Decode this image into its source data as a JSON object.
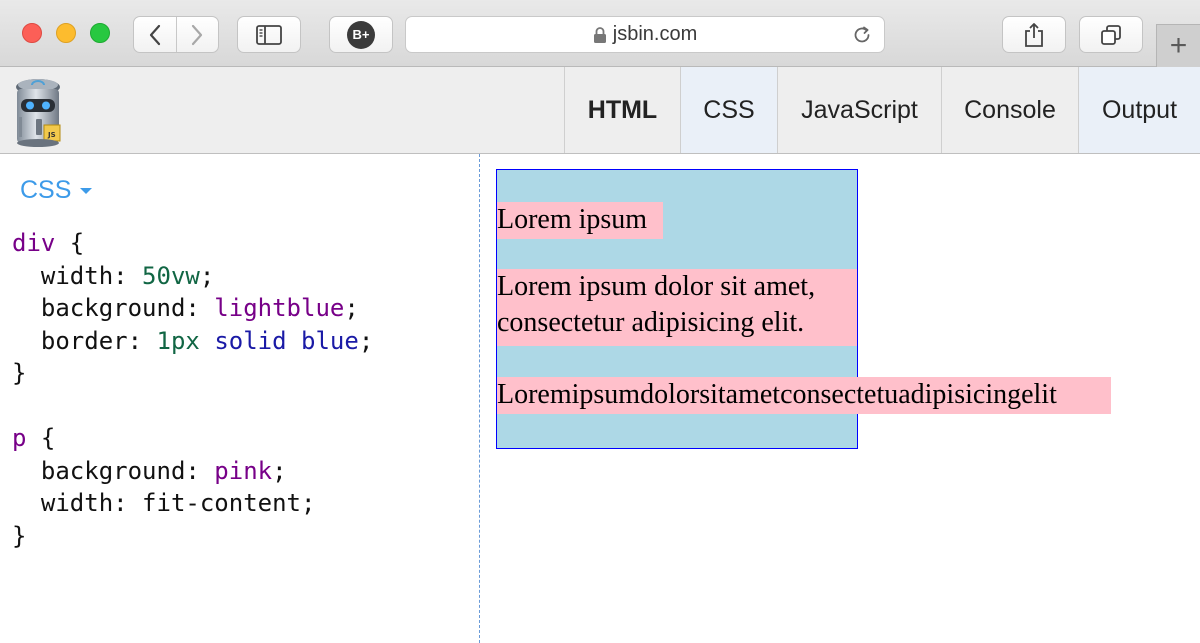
{
  "browser": {
    "url": "jsbin.com",
    "extension_badge": "B+",
    "new_tab_symbol": "+"
  },
  "jsbin": {
    "tabs": [
      {
        "label": "HTML",
        "active": false,
        "bold": true
      },
      {
        "label": "CSS",
        "active": true
      },
      {
        "label": "JavaScript",
        "active": false
      },
      {
        "label": "Console",
        "active": false
      },
      {
        "label": "Output",
        "active": true
      }
    ],
    "editor": {
      "panel_label": "CSS",
      "code_lines": [
        "div {",
        "  width: 50vw;",
        "  background: lightblue;",
        "  border: 1px solid blue;",
        "}",
        "",
        "p {",
        "  background: pink;",
        "  width: fit-content;",
        "}"
      ]
    },
    "output": {
      "paragraphs": [
        "Lorem ipsum",
        "Lorem ipsum dolor sit amet,\nconsectetur adipisicing elit.",
        "Loremipsumdolorsitametconsectetuadipisicingelit"
      ]
    }
  },
  "colors": {
    "div_background": "#add8e6",
    "div_border": "#0000ff",
    "paragraph_background": "#ffc0cb",
    "accent": "#3d9be9"
  }
}
